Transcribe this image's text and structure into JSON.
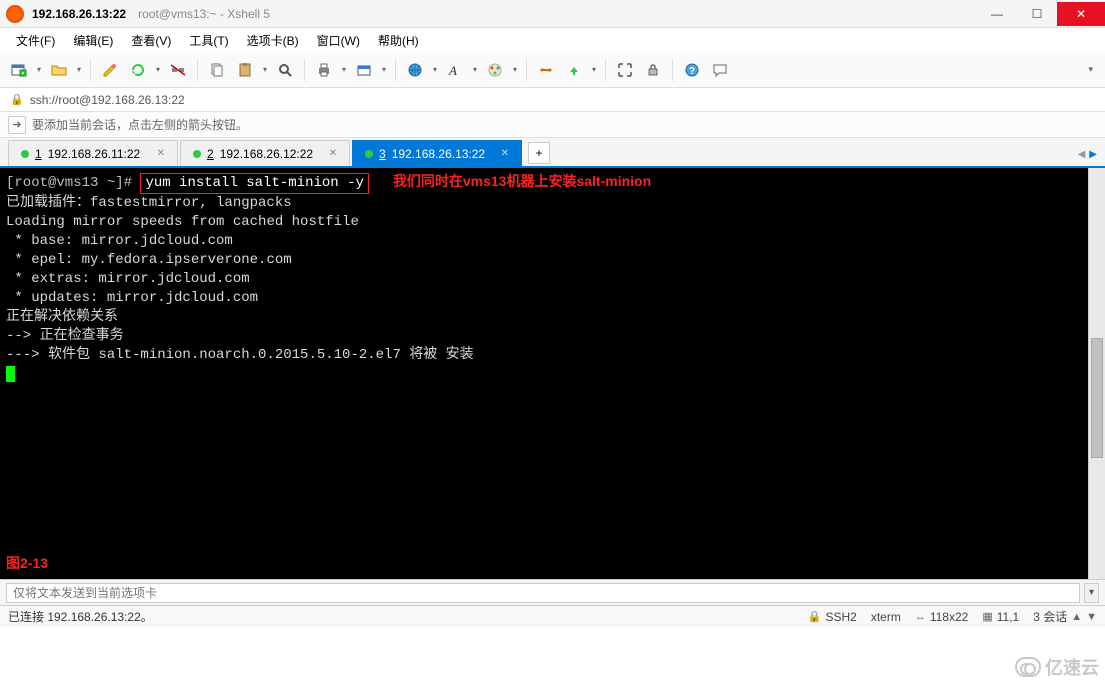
{
  "window": {
    "title_main": "192.168.26.13:22",
    "title_sub": "root@vms13:~ - Xshell 5"
  },
  "menu": {
    "items": [
      "文件(F)",
      "编辑(E)",
      "查看(V)",
      "工具(T)",
      "选项卡(B)",
      "窗口(W)",
      "帮助(H)"
    ]
  },
  "toolbar": {
    "icons": [
      "new-session",
      "open-session",
      "edit",
      "reconnect",
      "disconnect",
      "copy",
      "paste",
      "find",
      "print",
      "properties",
      "globe",
      "font",
      "color",
      "compose",
      "transfer",
      "fullscreen",
      "lock",
      "help",
      "chat"
    ]
  },
  "address": {
    "url": "ssh://root@192.168.26.13:22",
    "lock": "🔒"
  },
  "hint": {
    "text": "要添加当前会话，点击左侧的箭头按钮。",
    "arrow": "➜"
  },
  "tabs": {
    "items": [
      {
        "num": "1",
        "label": "192.168.26.11:22",
        "active": false
      },
      {
        "num": "2",
        "label": "192.168.26.12:22",
        "active": false
      },
      {
        "num": "3",
        "label": "192.168.26.13:22",
        "active": true
      }
    ],
    "add": "+"
  },
  "terminal": {
    "prompt": "[root@vms13 ~]#",
    "command": "yum install salt-minion -y",
    "annotation": "我们同时在vms13机器上安装salt-minion",
    "lines": [
      "已加载插件：fastestmirror, langpacks",
      "Loading mirror speeds from cached hostfile",
      " * base: mirror.jdcloud.com",
      " * epel: my.fedora.ipserverone.com",
      " * extras: mirror.jdcloud.com",
      " * updates: mirror.jdcloud.com",
      "正在解决依赖关系",
      "--> 正在检查事务",
      "---> 软件包 salt-minion.noarch.0.2015.5.10-2.el7 将被 安装"
    ],
    "figlabel": "图2-13"
  },
  "sendbar": {
    "placeholder": "仅将文本发送到当前选项卡"
  },
  "status": {
    "connected": "已连接 192.168.26.13:22。",
    "proto": "SSH2",
    "term": "xterm",
    "size": "118x22",
    "pos": "11,1",
    "sessions": "3 会话"
  },
  "watermark": {
    "text": "亿速云"
  }
}
